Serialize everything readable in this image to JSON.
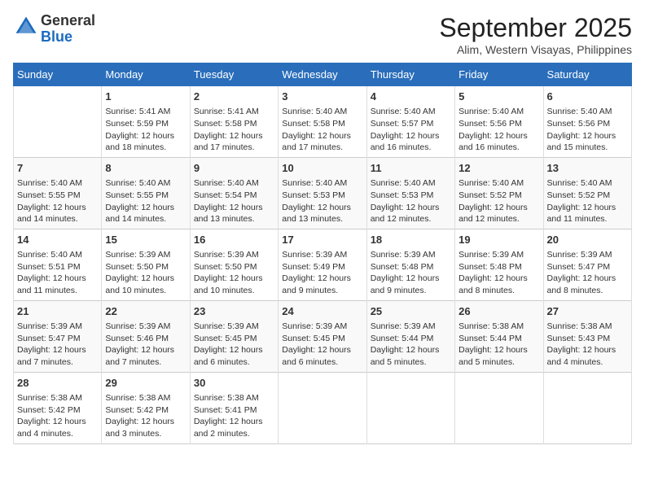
{
  "logo": {
    "line1": "General",
    "line2": "Blue"
  },
  "title": "September 2025",
  "location": "Alim, Western Visayas, Philippines",
  "weekdays": [
    "Sunday",
    "Monday",
    "Tuesday",
    "Wednesday",
    "Thursday",
    "Friday",
    "Saturday"
  ],
  "weeks": [
    [
      {
        "day": "",
        "info": ""
      },
      {
        "day": "1",
        "info": "Sunrise: 5:41 AM\nSunset: 5:59 PM\nDaylight: 12 hours\nand 18 minutes."
      },
      {
        "day": "2",
        "info": "Sunrise: 5:41 AM\nSunset: 5:58 PM\nDaylight: 12 hours\nand 17 minutes."
      },
      {
        "day": "3",
        "info": "Sunrise: 5:40 AM\nSunset: 5:58 PM\nDaylight: 12 hours\nand 17 minutes."
      },
      {
        "day": "4",
        "info": "Sunrise: 5:40 AM\nSunset: 5:57 PM\nDaylight: 12 hours\nand 16 minutes."
      },
      {
        "day": "5",
        "info": "Sunrise: 5:40 AM\nSunset: 5:56 PM\nDaylight: 12 hours\nand 16 minutes."
      },
      {
        "day": "6",
        "info": "Sunrise: 5:40 AM\nSunset: 5:56 PM\nDaylight: 12 hours\nand 15 minutes."
      }
    ],
    [
      {
        "day": "7",
        "info": "Sunrise: 5:40 AM\nSunset: 5:55 PM\nDaylight: 12 hours\nand 14 minutes."
      },
      {
        "day": "8",
        "info": "Sunrise: 5:40 AM\nSunset: 5:55 PM\nDaylight: 12 hours\nand 14 minutes."
      },
      {
        "day": "9",
        "info": "Sunrise: 5:40 AM\nSunset: 5:54 PM\nDaylight: 12 hours\nand 13 minutes."
      },
      {
        "day": "10",
        "info": "Sunrise: 5:40 AM\nSunset: 5:53 PM\nDaylight: 12 hours\nand 13 minutes."
      },
      {
        "day": "11",
        "info": "Sunrise: 5:40 AM\nSunset: 5:53 PM\nDaylight: 12 hours\nand 12 minutes."
      },
      {
        "day": "12",
        "info": "Sunrise: 5:40 AM\nSunset: 5:52 PM\nDaylight: 12 hours\nand 12 minutes."
      },
      {
        "day": "13",
        "info": "Sunrise: 5:40 AM\nSunset: 5:52 PM\nDaylight: 12 hours\nand 11 minutes."
      }
    ],
    [
      {
        "day": "14",
        "info": "Sunrise: 5:40 AM\nSunset: 5:51 PM\nDaylight: 12 hours\nand 11 minutes."
      },
      {
        "day": "15",
        "info": "Sunrise: 5:39 AM\nSunset: 5:50 PM\nDaylight: 12 hours\nand 10 minutes."
      },
      {
        "day": "16",
        "info": "Sunrise: 5:39 AM\nSunset: 5:50 PM\nDaylight: 12 hours\nand 10 minutes."
      },
      {
        "day": "17",
        "info": "Sunrise: 5:39 AM\nSunset: 5:49 PM\nDaylight: 12 hours\nand 9 minutes."
      },
      {
        "day": "18",
        "info": "Sunrise: 5:39 AM\nSunset: 5:48 PM\nDaylight: 12 hours\nand 9 minutes."
      },
      {
        "day": "19",
        "info": "Sunrise: 5:39 AM\nSunset: 5:48 PM\nDaylight: 12 hours\nand 8 minutes."
      },
      {
        "day": "20",
        "info": "Sunrise: 5:39 AM\nSunset: 5:47 PM\nDaylight: 12 hours\nand 8 minutes."
      }
    ],
    [
      {
        "day": "21",
        "info": "Sunrise: 5:39 AM\nSunset: 5:47 PM\nDaylight: 12 hours\nand 7 minutes."
      },
      {
        "day": "22",
        "info": "Sunrise: 5:39 AM\nSunset: 5:46 PM\nDaylight: 12 hours\nand 7 minutes."
      },
      {
        "day": "23",
        "info": "Sunrise: 5:39 AM\nSunset: 5:45 PM\nDaylight: 12 hours\nand 6 minutes."
      },
      {
        "day": "24",
        "info": "Sunrise: 5:39 AM\nSunset: 5:45 PM\nDaylight: 12 hours\nand 6 minutes."
      },
      {
        "day": "25",
        "info": "Sunrise: 5:39 AM\nSunset: 5:44 PM\nDaylight: 12 hours\nand 5 minutes."
      },
      {
        "day": "26",
        "info": "Sunrise: 5:38 AM\nSunset: 5:44 PM\nDaylight: 12 hours\nand 5 minutes."
      },
      {
        "day": "27",
        "info": "Sunrise: 5:38 AM\nSunset: 5:43 PM\nDaylight: 12 hours\nand 4 minutes."
      }
    ],
    [
      {
        "day": "28",
        "info": "Sunrise: 5:38 AM\nSunset: 5:42 PM\nDaylight: 12 hours\nand 4 minutes."
      },
      {
        "day": "29",
        "info": "Sunrise: 5:38 AM\nSunset: 5:42 PM\nDaylight: 12 hours\nand 3 minutes."
      },
      {
        "day": "30",
        "info": "Sunrise: 5:38 AM\nSunset: 5:41 PM\nDaylight: 12 hours\nand 2 minutes."
      },
      {
        "day": "",
        "info": ""
      },
      {
        "day": "",
        "info": ""
      },
      {
        "day": "",
        "info": ""
      },
      {
        "day": "",
        "info": ""
      }
    ]
  ]
}
